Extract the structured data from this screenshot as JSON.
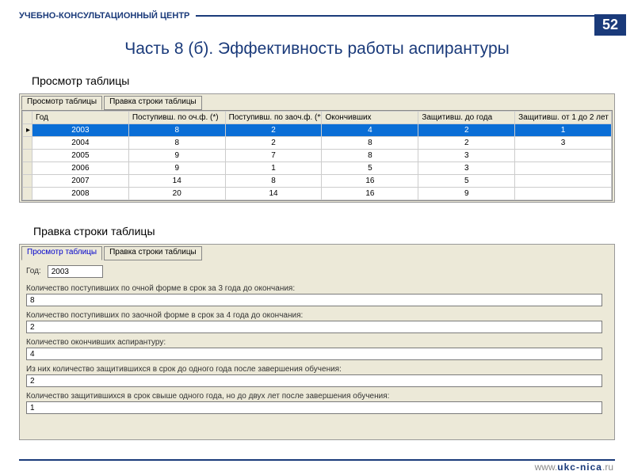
{
  "header": {
    "org": "УЧЕБНО-КОНСУЛЬТАЦИОННЫЙ ЦЕНТР",
    "page": "52"
  },
  "title": "Часть 8 (б). Эффективность работы аспирантуры",
  "sections": {
    "view": "Просмотр  таблицы",
    "edit": "Правка строки таблицы"
  },
  "tabs": {
    "view": "Просмотр таблицы",
    "edit": "Правка строки таблицы"
  },
  "columns": [
    "Год",
    "Поступивш. по оч.ф. (*)",
    "Поступивш. по заоч.ф. (**)",
    "Окончивших",
    "Защитивш. до года",
    "Защитивш. от 1 до 2 лет"
  ],
  "rows": [
    {
      "year": "2003",
      "c1": "8",
      "c2": "2",
      "c3": "4",
      "c4": "2",
      "c5": "1",
      "selected": true,
      "marker": "▸"
    },
    {
      "year": "2004",
      "c1": "8",
      "c2": "2",
      "c3": "8",
      "c4": "2",
      "c5": "3"
    },
    {
      "year": "2005",
      "c1": "9",
      "c2": "7",
      "c3": "8",
      "c4": "3",
      "c5": ""
    },
    {
      "year": "2006",
      "c1": "9",
      "c2": "1",
      "c3": "5",
      "c4": "3",
      "c5": ""
    },
    {
      "year": "2007",
      "c1": "14",
      "c2": "8",
      "c3": "16",
      "c4": "5",
      "c5": ""
    },
    {
      "year": "2008",
      "c1": "20",
      "c2": "14",
      "c3": "16",
      "c4": "9",
      "c5": ""
    }
  ],
  "form": {
    "yearLabel": "Год:",
    "yearValue": "2003",
    "f1": {
      "label": "Количество поступивших по очной форме в срок за 3 года до окончания:",
      "value": "8"
    },
    "f2": {
      "label": "Количество поступивших по заочной форме в срок за 4 года до окончания:",
      "value": "2"
    },
    "f3": {
      "label": "Количество окончивших аспирантуру:",
      "value": "4"
    },
    "f4": {
      "label": "Из них количество защитившихся в срок до одного года после завершения обучения:",
      "value": "2"
    },
    "f5": {
      "label": "Количество защитившихся в срок свыше одного года, но до двух лет после завершения обучения:",
      "value": "1"
    }
  },
  "footer": {
    "prefix": "www.",
    "domain": "ukc-nica",
    "tld": ".ru"
  }
}
